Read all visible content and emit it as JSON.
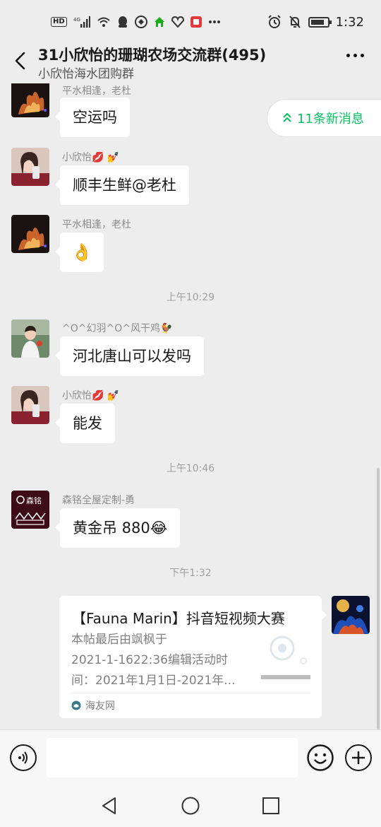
{
  "status_bar": {
    "left_icons": [
      "hd-icon",
      "4g-signal-icon",
      "wifi-icon",
      "qq-icon",
      "app-icon",
      "home-app-icon",
      "shield-app-icon",
      "red-app-icon",
      "more-notifications-icon"
    ],
    "hd": "HD",
    "net": "4G",
    "time": "1:32"
  },
  "nav": {
    "title": "31小欣怡的珊瑚农场交流群(495)",
    "subtitle": "小欣怡海水团购群"
  },
  "new_messages": {
    "label": "11条新消息"
  },
  "messages": [
    {
      "sender": "平水相逢，老杜",
      "text": "空运吗",
      "avatar": "flame-avatar"
    },
    {
      "sender": "小欣怡💋 💅",
      "text": "顺丰生鲜@老杜",
      "avatar": "girl-avatar"
    },
    {
      "sender": "平水相逢，老杜",
      "text": "👌",
      "avatar": "flame-avatar"
    },
    {
      "sender": "^O^幻羽^O^风干鸡🐓",
      "text": "河北唐山可以发吗",
      "avatar": "child-avatar"
    },
    {
      "sender": "小欣怡💋 💅",
      "text": "能发",
      "avatar": "girl-avatar"
    },
    {
      "sender": "森铭全屋定制-勇",
      "text": "黄金吊 880😂",
      "avatar": "senming-logo-avatar"
    }
  ],
  "timestamps": [
    "上午10:29",
    "上午10:46",
    "下午1:32"
  ],
  "card": {
    "title": "【Fauna Marin】抖音短视频大赛",
    "desc_lines": [
      "本帖最后由飒枫于",
      "2021-1-1622:36编辑活动时",
      "间：2021年1月1日-2021年..."
    ],
    "source": "海友网"
  },
  "avatar_logo": {
    "text": "森铭"
  },
  "colors": {
    "background": "#ededed",
    "bubble": "#ffffff",
    "accent": "#07c160",
    "time_text": "#a0a0a0"
  }
}
